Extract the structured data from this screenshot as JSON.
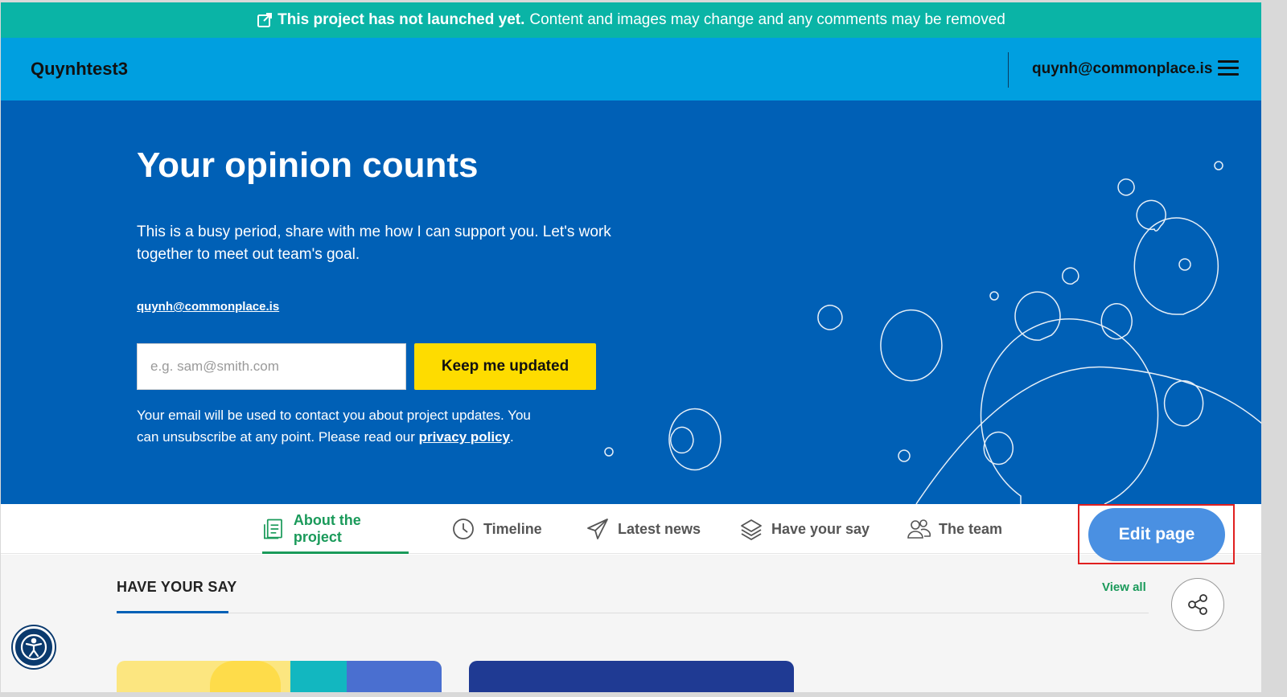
{
  "banner": {
    "bold_text": "This project has not launched yet.",
    "text": "Content and images may change and any comments may be removed"
  },
  "header": {
    "brand": "Quynhtest3",
    "user_email": "quynh@commonplace.is"
  },
  "hero": {
    "title": "Your opinion counts",
    "description": "This is a busy period, share with me how I can support you. Let's work together to meet out team's goal.",
    "contact_email": "quynh@commonplace.is",
    "email_placeholder": "e.g. sam@smith.com",
    "email_value": "",
    "subscribe_button": "Keep me updated",
    "note_before": "Your email will be used to contact you about project updates. You can unsubscribe at any point. Please read our",
    "note_link": "privacy policy",
    "note_after": "."
  },
  "tabs": [
    {
      "label": "About the project",
      "icon": "document-icon",
      "active": true
    },
    {
      "label": "Timeline",
      "icon": "clock-icon",
      "active": false
    },
    {
      "label": "Latest news",
      "icon": "paper-plane-icon",
      "active": false
    },
    {
      "label": "Have your say",
      "icon": "layers-icon",
      "active": false
    },
    {
      "label": "The team",
      "icon": "people-icon",
      "active": false
    }
  ],
  "edit_button": "Edit page",
  "section": {
    "title": "HAVE YOUR SAY",
    "view_all": "View all"
  },
  "colors": {
    "banner": "#0ab4a6",
    "header": "#009fe0",
    "hero": "#0060b6",
    "accent_green": "#1a9a5a",
    "cta_yellow": "#fedc00",
    "edit_blue": "#4a90e2"
  }
}
